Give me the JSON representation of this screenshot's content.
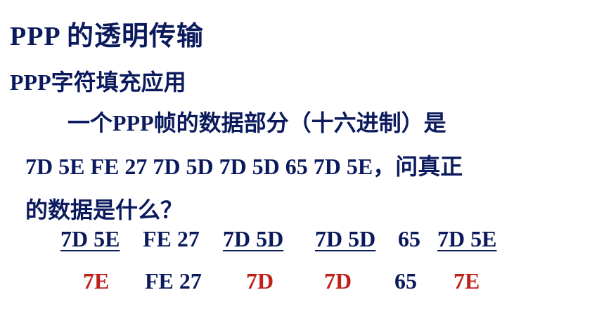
{
  "slide": {
    "title": "PPP 的透明传输",
    "subtitle": "PPP字符填充应用",
    "question_line1": "一个PPP帧的数据部分（十六进制）是",
    "question_line2": "7D 5E FE 27 7D 5D 7D 5D 65 7D 5E，问真正",
    "question_line3": "的数据是什么？",
    "escaped": [
      "7D 5E",
      "FE 27",
      "7D 5D",
      "7D 5D",
      "65",
      "7D 5E"
    ],
    "decoded": [
      "7E",
      "FE 27",
      "7D",
      "7D",
      "65",
      "7E"
    ]
  },
  "colors": {
    "text": "#0b1a5c",
    "highlight": "#c0201a"
  }
}
